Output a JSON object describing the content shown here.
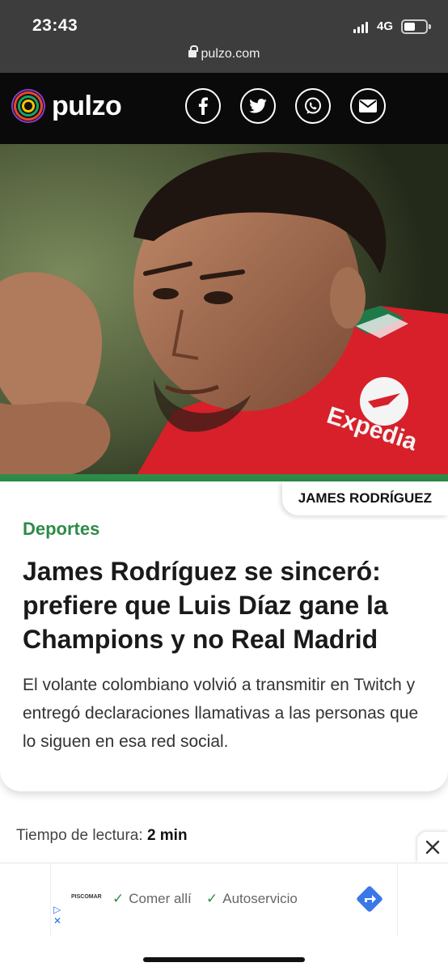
{
  "status_bar": {
    "time": "23:43",
    "network": "4G"
  },
  "browser": {
    "url": "pulzo.com"
  },
  "header": {
    "logo_text": "pulzo",
    "share_icons": [
      "facebook-icon",
      "twitter-icon",
      "whatsapp-icon",
      "email-icon"
    ]
  },
  "hero": {
    "image_alt": "Futbolista con camiseta roja Expedia haciendo un corazón con las manos"
  },
  "article": {
    "tag": "JAMES RODRÍGUEZ",
    "section": "Deportes",
    "headline": "James Rodríguez se sinceró: prefiere que Luis Díaz gane la Champions y no Real Madrid",
    "summary": "El volante colombiano volvió a transmitir en Twitch y entregó declaraciones llamativas a las personas que lo siguen en esa red social.",
    "reading_label": "Tiempo de lectura:",
    "reading_value": "2 min"
  },
  "ad": {
    "brand": "PISCOMAR",
    "item1": "Comer allí",
    "item2": "Autoservicio"
  },
  "colors": {
    "accent_green": "#2e8b48",
    "header_bg": "#0a0a0a",
    "jersey_red": "#d7202a"
  }
}
